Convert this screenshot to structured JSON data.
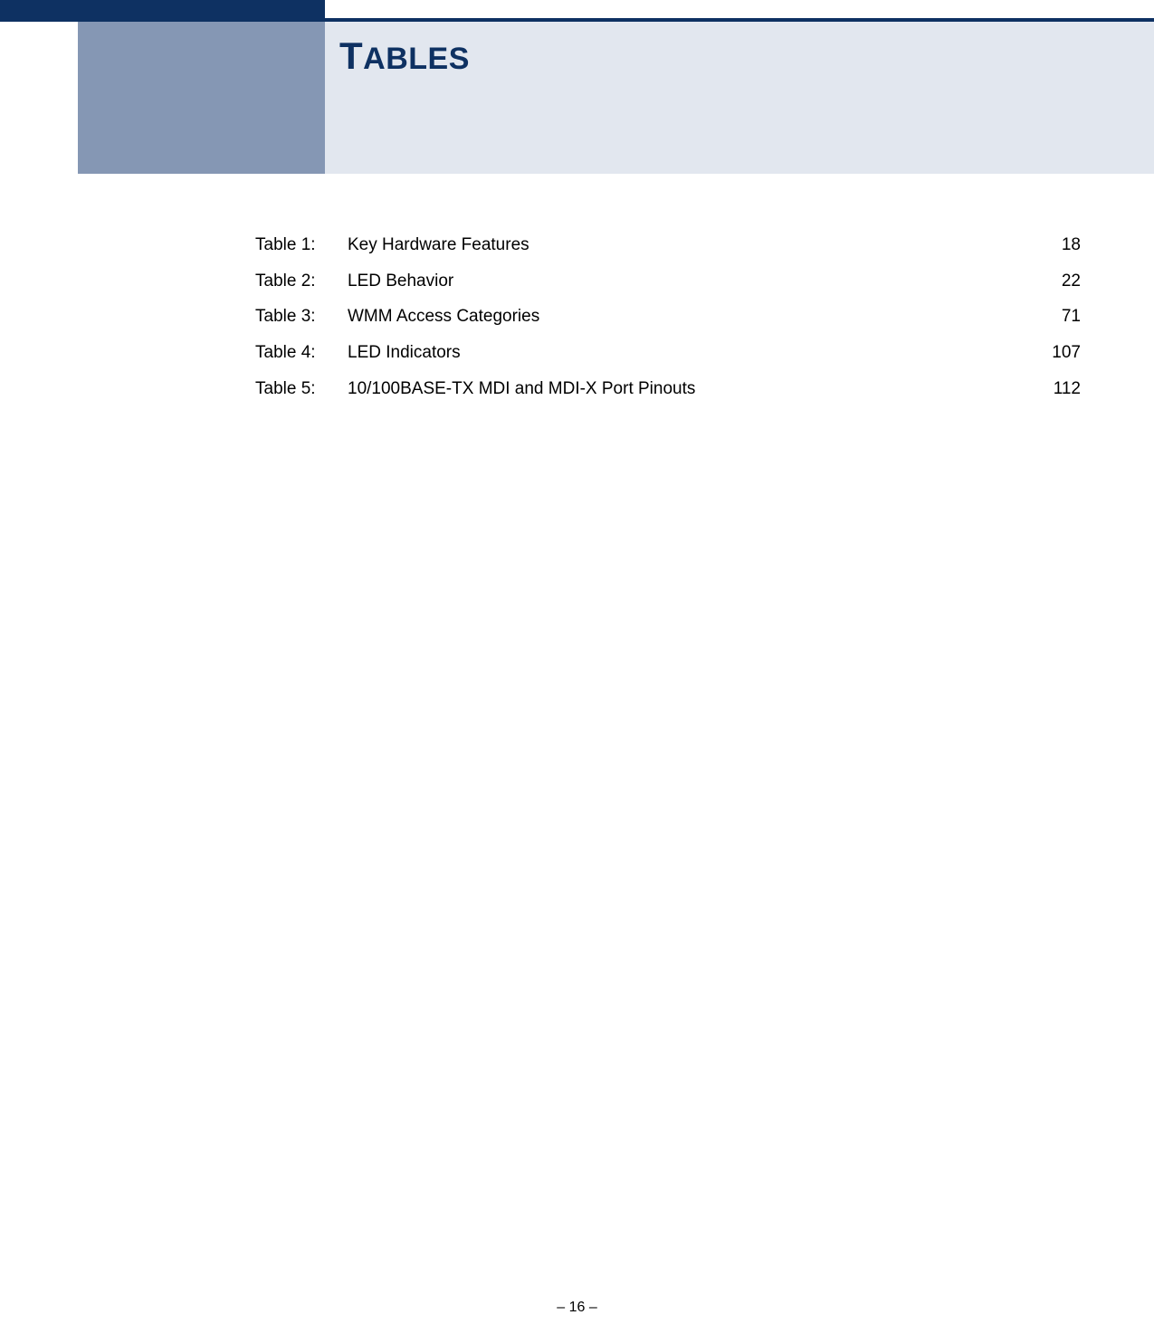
{
  "header": {
    "title_first_letter": "T",
    "title_rest": "ABLES"
  },
  "toc": {
    "entries": [
      {
        "label": "Table 1:",
        "title": "Key Hardware Features",
        "page": "18"
      },
      {
        "label": "Table 2:",
        "title": "LED Behavior",
        "page": "22"
      },
      {
        "label": "Table 3:",
        "title": "WMM Access Categories",
        "page": "71"
      },
      {
        "label": "Table 4:",
        "title": "LED Indicators",
        "page": "107"
      },
      {
        "label": "Table 5:",
        "title": "10/100BASE-TX MDI and MDI-X Port Pinouts",
        "page": "112"
      }
    ]
  },
  "footer": {
    "page_number": "–  16  –"
  }
}
